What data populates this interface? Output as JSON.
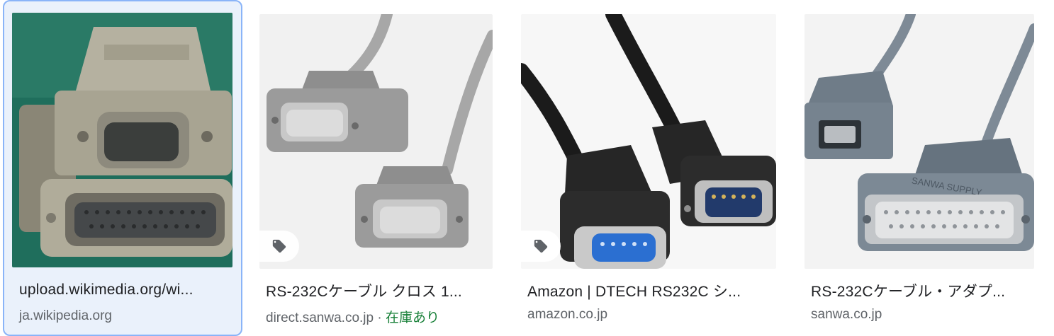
{
  "results": [
    {
      "title": "upload.wikimedia.org/wi...",
      "source": "ja.wikipedia.org",
      "stock": "",
      "has_shopping_tag": false
    },
    {
      "title": "RS-232Cケーブル クロス 1...",
      "source": "direct.sanwa.co.jp",
      "separator": " · ",
      "stock": "在庫あり",
      "has_shopping_tag": true
    },
    {
      "title": "Amazon | DTECH RS232C シ...",
      "source": "amazon.co.jp",
      "stock": "",
      "has_shopping_tag": true
    },
    {
      "title": "RS-232Cケーブル・アダプ...",
      "source": "sanwa.co.jp",
      "stock": "",
      "has_shopping_tag": false
    }
  ],
  "colors": {
    "selected_border": "#8ab4f8",
    "selected_bg": "#eaf1fb",
    "title_text": "#202124",
    "source_text": "#5f6368",
    "stock_text": "#188038"
  },
  "icons": {
    "tag": "shopping-tag-icon"
  }
}
